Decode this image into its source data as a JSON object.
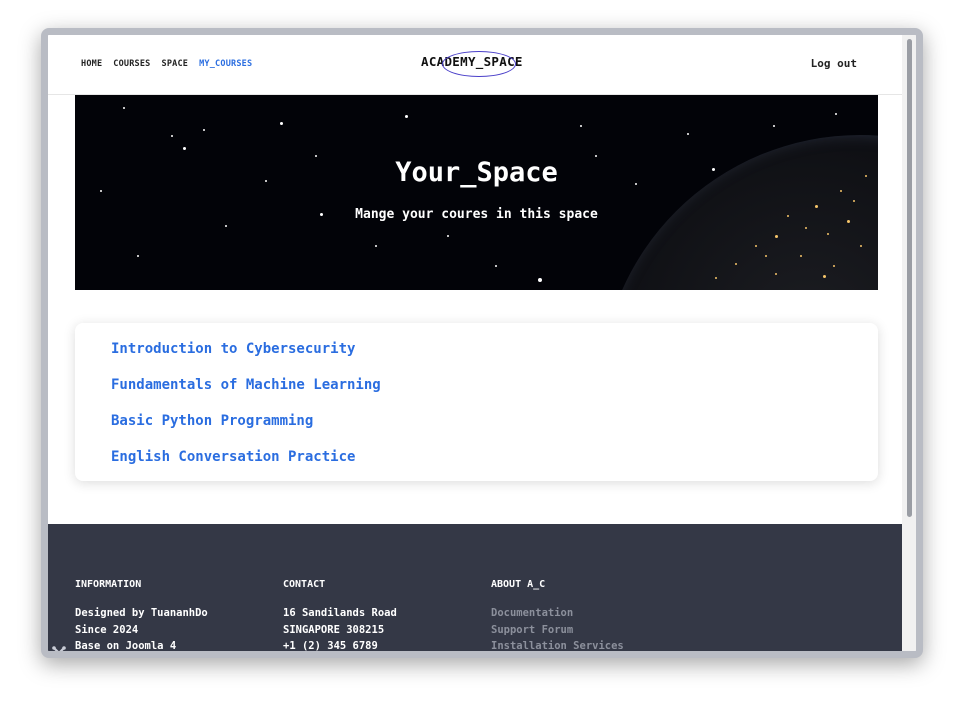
{
  "header": {
    "nav": [
      "HOME",
      "COURSES",
      "SPACE",
      "MY_COURSES"
    ],
    "active_nav": "MY_COURSES",
    "brand": "ACADEMY_SPACE",
    "logout": "Log out"
  },
  "hero": {
    "title": "Your_Space",
    "subtitle": "Mange your coures in this space"
  },
  "courses": [
    "Introduction to Cybersecurity",
    "Fundamentals of Machine Learning",
    "Basic Python Programming",
    "English Conversation Practice"
  ],
  "footer": {
    "information": {
      "heading": "INFORMATION",
      "lines": [
        "Designed by TuananhDo",
        "Since 2024",
        "Base on Joomla 4"
      ]
    },
    "contact": {
      "heading": "CONTACT",
      "lines": [
        "16 Sandilands Road",
        "SINGAPORE 308215",
        "+1 (2) 345 6789"
      ]
    },
    "about": {
      "heading": "ABOUT A_C",
      "links": [
        "Documentation",
        "Support Forum",
        "Installation Services"
      ]
    }
  },
  "colors": {
    "accent": "#2a6de0",
    "footer_bg": "#343846",
    "footer_link": "#8c909c",
    "brand_ring": "#4a3fc9"
  },
  "icons": {
    "footer_badge": "joomla-icon"
  }
}
